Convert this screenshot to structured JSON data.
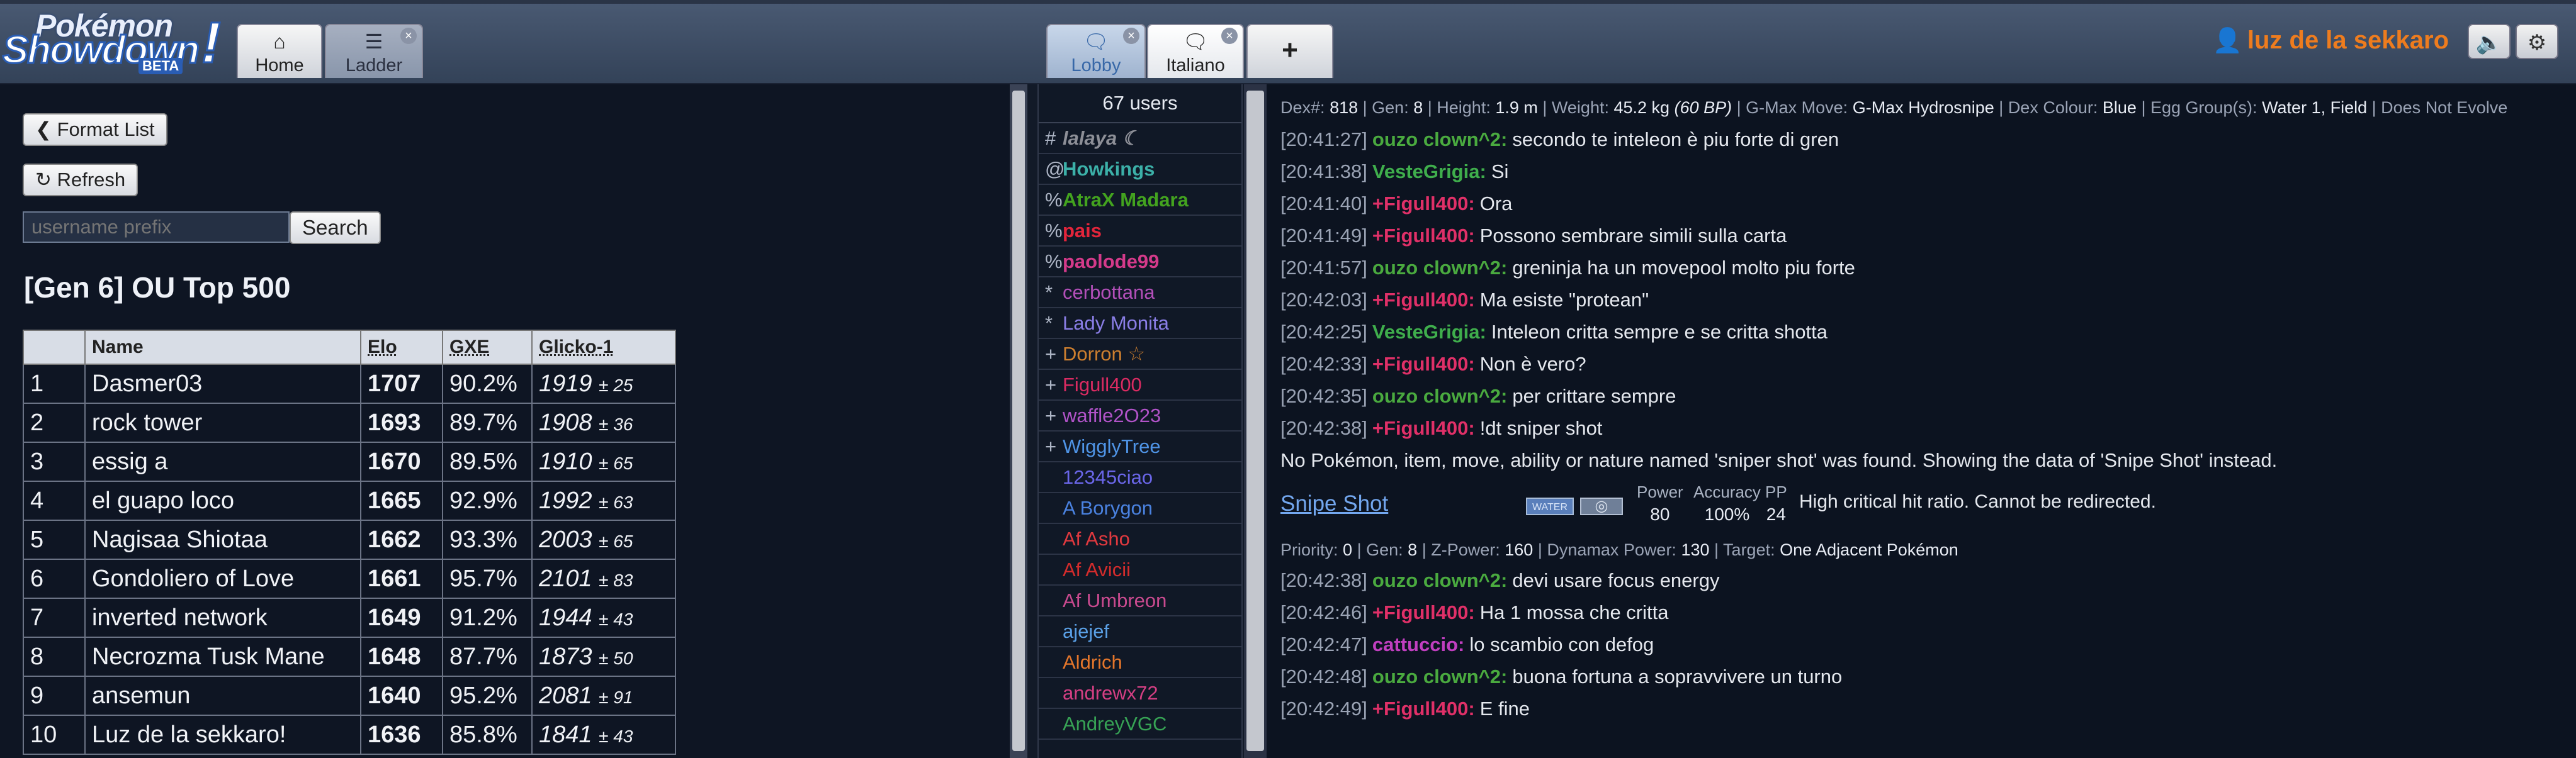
{
  "header": {
    "logo": {
      "line1": "Pokémon",
      "line2": "Showdown",
      "badge": "BETA"
    },
    "tabs": [
      {
        "label": "Home",
        "icon": "home-icon",
        "glyph": "⌂"
      },
      {
        "label": "Ladder",
        "icon": "list-icon",
        "glyph": "☰"
      }
    ],
    "room_tabs": [
      {
        "label": "Lobby",
        "icon": "chat-icon",
        "glyph": "🗨"
      },
      {
        "label": "Italiano",
        "icon": "chat-outline-icon",
        "glyph": "🗨"
      }
    ],
    "new_tab_glyph": "+",
    "username": "luz de la sekkaro",
    "sound_glyph": "🔈",
    "settings_glyph": "⚙"
  },
  "ladder": {
    "format_list_button": "Format List",
    "refresh_button": "Refresh",
    "search_placeholder": "username prefix",
    "search_button": "Search",
    "title": "[Gen 6] OU Top 500",
    "columns": [
      "",
      "Name",
      "Elo",
      "GXE",
      "Glicko-1"
    ],
    "rows": [
      {
        "rank": "1",
        "name": "Dasmer03",
        "elo": "1707",
        "gxe": "90.2%",
        "glicko": "1919",
        "dev": "± 25"
      },
      {
        "rank": "2",
        "name": "rock tower",
        "elo": "1693",
        "gxe": "89.7%",
        "glicko": "1908",
        "dev": "± 36"
      },
      {
        "rank": "3",
        "name": "essig a",
        "elo": "1670",
        "gxe": "89.5%",
        "glicko": "1910",
        "dev": "± 65"
      },
      {
        "rank": "4",
        "name": "el guapo loco",
        "elo": "1665",
        "gxe": "92.9%",
        "glicko": "1992",
        "dev": "± 63"
      },
      {
        "rank": "5",
        "name": "Nagisaa Shiotaa",
        "elo": "1662",
        "gxe": "93.3%",
        "glicko": "2003",
        "dev": "± 65"
      },
      {
        "rank": "6",
        "name": "Gondoliero of Love",
        "elo": "1661",
        "gxe": "95.7%",
        "glicko": "2101",
        "dev": "± 83"
      },
      {
        "rank": "7",
        "name": "inverted network",
        "elo": "1649",
        "gxe": "91.2%",
        "glicko": "1944",
        "dev": "± 43"
      },
      {
        "rank": "8",
        "name": "Necrozma Tusk Mane",
        "elo": "1648",
        "gxe": "87.7%",
        "glicko": "1873",
        "dev": "± 50"
      },
      {
        "rank": "9",
        "name": "ansemun",
        "elo": "1640",
        "gxe": "95.2%",
        "glicko": "2081",
        "dev": "± 91"
      },
      {
        "rank": "10",
        "name": "Luz de la sekkaro!",
        "elo": "1636",
        "gxe": "85.8%",
        "glicko": "1841",
        "dev": "± 43"
      }
    ]
  },
  "userlist": {
    "count": "67 users",
    "users": [
      {
        "rank": "#",
        "name": "lalaya ☾",
        "color": "#8d8f97",
        "bold": true,
        "italic": true
      },
      {
        "rank": "@",
        "name": "Howkings",
        "color": "#3cb0a8",
        "bold": true
      },
      {
        "rank": "%",
        "name": "AtraX Madara",
        "color": "#43a31f",
        "bold": true
      },
      {
        "rank": "%",
        "name": "pais",
        "color": "#e3253b",
        "bold": true
      },
      {
        "rank": "%",
        "name": "paolode99",
        "color": "#d43a8a",
        "bold": true
      },
      {
        "rank": "*",
        "name": "cerbottana",
        "color": "#b24fb8"
      },
      {
        "rank": "*",
        "name": "Lady Monita",
        "color": "#8a7ee6"
      },
      {
        "rank": "+",
        "name": "Dorron ☆",
        "color": "#cd7f2f"
      },
      {
        "rank": "+",
        "name": "Figull400",
        "color": "#da2b62"
      },
      {
        "rank": "+",
        "name": "waffle2O23",
        "color": "#b153c8"
      },
      {
        "rank": "+",
        "name": "WigglyTree",
        "color": "#4f94e6"
      },
      {
        "rank": "",
        "name": "12345ciao",
        "color": "#6a66e8"
      },
      {
        "rank": "",
        "name": "A Borygon",
        "color": "#4a82e0"
      },
      {
        "rank": "",
        "name": "Af Asho",
        "color": "#e0393f"
      },
      {
        "rank": "",
        "name": "Af Avicii",
        "color": "#d42c2c"
      },
      {
        "rank": "",
        "name": "Af Umbreon",
        "color": "#c94a8f"
      },
      {
        "rank": "",
        "name": "ajejef",
        "color": "#5aa0e6"
      },
      {
        "rank": "",
        "name": "Aldrich",
        "color": "#e4762b"
      },
      {
        "rank": "",
        "name": "andrewx72",
        "color": "#d43f83"
      },
      {
        "rank": "",
        "name": "AndreyVGC",
        "color": "#37a355"
      }
    ]
  },
  "chat": {
    "dex_line": {
      "dex_label": "Dex#:",
      "dex": "818",
      "gen_label": "Gen:",
      "gen": "8",
      "height_label": "Height:",
      "height": "1.9 m",
      "weight_label": "Weight:",
      "weight": "45.2 kg",
      "weight_bp": "(60 BP)",
      "gmax_label": "G-Max Move:",
      "gmax": "G-Max Hydrosnipe",
      "colour_label": "Dex Colour:",
      "colour": "Blue",
      "egg_label": "Egg Group(s):",
      "egg": "Water 1, Field",
      "evolve": "Does Not Evolve"
    },
    "messages_before": [
      {
        "time": "[20:41:27]",
        "user": "ouzo clown^2:",
        "color": "#4aaa3f",
        "text": "secondo te inteleon è piu forte di gren"
      },
      {
        "time": "[20:41:38]",
        "user": "VesteGrigia:",
        "color": "#3fae4c",
        "text": "Si"
      },
      {
        "time": "[20:41:40]",
        "user": "+Figull400:",
        "color": "#e03068",
        "text": "Ora"
      },
      {
        "time": "[20:41:49]",
        "user": "+Figull400:",
        "color": "#e03068",
        "text": "Possono sembrare simili sulla carta"
      },
      {
        "time": "[20:41:57]",
        "user": "ouzo clown^2:",
        "color": "#4aaa3f",
        "text": "greninja ha un movepool molto piu forte"
      },
      {
        "time": "[20:42:03]",
        "user": "+Figull400:",
        "color": "#e03068",
        "text": "Ma esiste \"protean\""
      },
      {
        "time": "[20:42:25]",
        "user": "VesteGrigia:",
        "color": "#3fae4c",
        "text": "Inteleon critta sempre e se critta shotta"
      },
      {
        "time": "[20:42:33]",
        "user": "+Figull400:",
        "color": "#e03068",
        "text": "Non è vero?"
      },
      {
        "time": "[20:42:35]",
        "user": "ouzo clown^2:",
        "color": "#4aaa3f",
        "text": "per crittare sempre"
      },
      {
        "time": "[20:42:38]",
        "user": "+Figull400:",
        "color": "#e03068",
        "text": "!dt sniper shot"
      }
    ],
    "notice": "No Pokémon, item, move, ability or nature named 'sniper shot' was found. Showing the data of 'Snipe Shot' instead.",
    "move": {
      "name": "Snipe Shot",
      "type": "WATER",
      "category_glyph": "◎",
      "power_label": "Power",
      "power": "80",
      "accuracy_label": "Accuracy",
      "accuracy": "100%",
      "pp_label": "PP",
      "pp": "24",
      "desc": "High critical hit ratio. Cannot be redirected."
    },
    "priority_line": {
      "priority_label": "Priority:",
      "priority": "0",
      "gen_label": "Gen:",
      "gen": "8",
      "zpower_label": "Z-Power:",
      "zpower": "160",
      "dmax_label": "Dynamax Power:",
      "dmax": "130",
      "target_label": "Target:",
      "target": "One Adjacent Pokémon"
    },
    "messages_after": [
      {
        "time": "[20:42:38]",
        "user": "ouzo clown^2:",
        "color": "#4aaa3f",
        "text": "devi usare focus energy"
      },
      {
        "time": "[20:42:46]",
        "user": "+Figull400:",
        "color": "#e03068",
        "text": "Ha 1 mossa che critta"
      },
      {
        "time": "[20:42:47]",
        "user": "cattuccio:",
        "color": "#c13fc0",
        "text": "lo scambio con defog"
      },
      {
        "time": "[20:42:48]",
        "user": "ouzo clown^2:",
        "color": "#4aaa3f",
        "text": "buona fortuna a sopravvivere un turno"
      },
      {
        "time": "[20:42:49]",
        "user": "+Figull400:",
        "color": "#e03068",
        "text": "E fine"
      }
    ]
  }
}
